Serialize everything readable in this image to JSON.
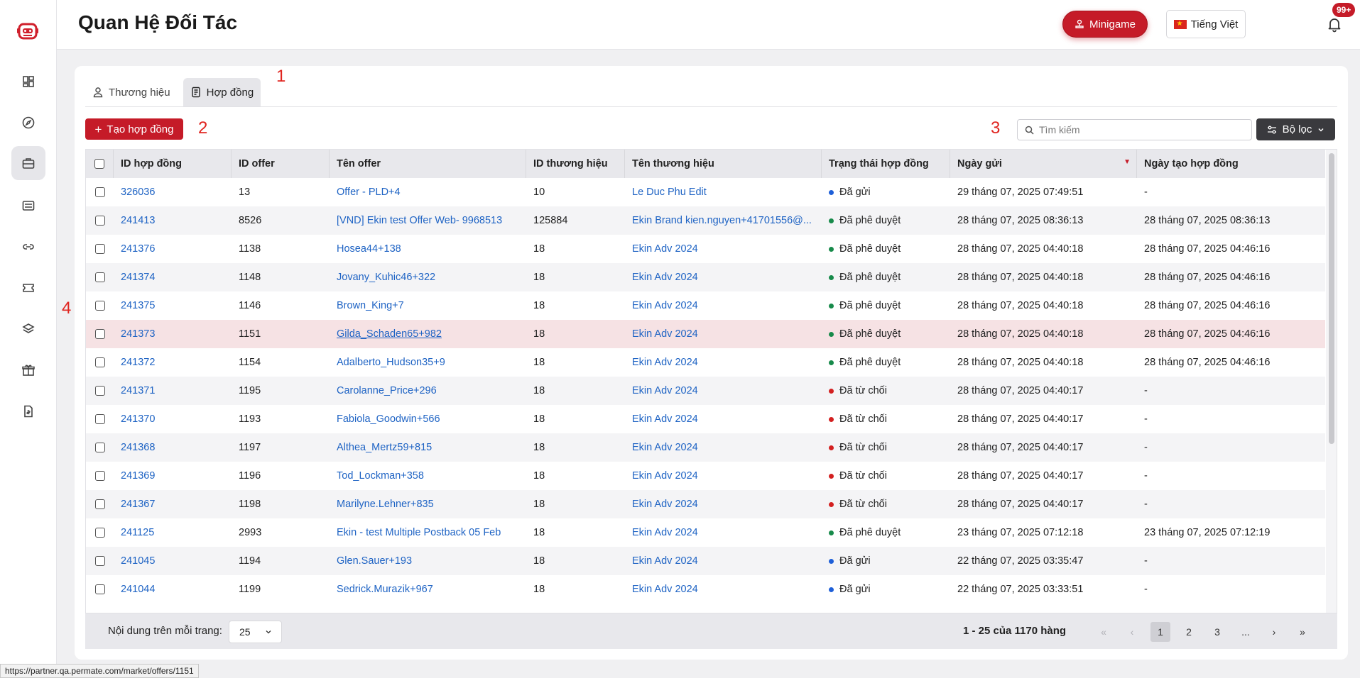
{
  "header": {
    "title": "Quan Hệ Đối Tác",
    "minigame_label": "Minigame",
    "language_label": "Tiếng Việt",
    "notification_badge": "99+"
  },
  "sidebar": {
    "items": [
      {
        "icon": "dashboard-icon",
        "active": false
      },
      {
        "icon": "compass-icon",
        "active": false
      },
      {
        "icon": "briefcase-icon",
        "active": true
      },
      {
        "icon": "sliders-icon",
        "active": false
      },
      {
        "icon": "link-icon",
        "active": false
      },
      {
        "icon": "ticket-icon",
        "active": false
      },
      {
        "icon": "layers-icon",
        "active": false
      },
      {
        "icon": "gift-icon",
        "active": false
      },
      {
        "icon": "invoice-icon",
        "active": false
      }
    ]
  },
  "tabs": [
    {
      "label": "Thương hiệu",
      "active": false,
      "icon": "user-icon"
    },
    {
      "label": "Hợp đồng",
      "active": true,
      "icon": "contract-icon"
    }
  ],
  "annotations": {
    "a1": "1",
    "a2": "2",
    "a3": "3",
    "a4": "4"
  },
  "toolbar": {
    "create_label": "Tạo hợp đồng",
    "search_placeholder": "Tìm kiếm",
    "filter_label": "Bộ lọc"
  },
  "table": {
    "columns": [
      "ID hợp đồng",
      "ID offer",
      "Tên offer",
      "ID thương hiệu",
      "Tên thương hiệu",
      "Trạng thái hợp đồng",
      "Ngày gửi",
      "Ngày tạo hợp đồng"
    ],
    "status_colors": {
      "sent": "#1e5fd8",
      "approved": "#178a4a",
      "rejected": "#d32020"
    },
    "rows": [
      {
        "id": "326036",
        "offer_id": "13",
        "offer_name": "Offer - PLD+4",
        "brand_id": "10",
        "brand_name": "Le Duc Phu Edit",
        "status": "Đã gửi",
        "status_type": "sent",
        "sent": "29 tháng 07, 2025 07:49:51",
        "created": "-"
      },
      {
        "id": "241413",
        "offer_id": "8526",
        "offer_name": "[VND] Ekin test Offer Web- 9968513",
        "brand_id": "125884",
        "brand_name": "Ekin Brand kien.nguyen+41701556@...",
        "status": "Đã phê duyệt",
        "status_type": "approved",
        "sent": "28 tháng 07, 2025 08:36:13",
        "created": "28 tháng 07, 2025 08:36:13"
      },
      {
        "id": "241376",
        "offer_id": "1138",
        "offer_name": "Hosea44+138",
        "brand_id": "18",
        "brand_name": "Ekin Adv 2024",
        "status": "Đã phê duyệt",
        "status_type": "approved",
        "sent": "28 tháng 07, 2025 04:40:18",
        "created": "28 tháng 07, 2025 04:46:16"
      },
      {
        "id": "241374",
        "offer_id": "1148",
        "offer_name": "Jovany_Kuhic46+322",
        "brand_id": "18",
        "brand_name": "Ekin Adv 2024",
        "status": "Đã phê duyệt",
        "status_type": "approved",
        "sent": "28 tháng 07, 2025 04:40:18",
        "created": "28 tháng 07, 2025 04:46:16"
      },
      {
        "id": "241375",
        "offer_id": "1146",
        "offer_name": "Brown_King+7",
        "brand_id": "18",
        "brand_name": "Ekin Adv 2024",
        "status": "Đã phê duyệt",
        "status_type": "approved",
        "sent": "28 tháng 07, 2025 04:40:18",
        "created": "28 tháng 07, 2025 04:46:16"
      },
      {
        "id": "241373",
        "offer_id": "1151",
        "offer_name": "Gilda_Schaden65+982",
        "brand_id": "18",
        "brand_name": "Ekin Adv 2024",
        "status": "Đã phê duyệt",
        "status_type": "approved",
        "sent": "28 tháng 07, 2025 04:40:18",
        "created": "28 tháng 07, 2025 04:46:16",
        "hovered": true
      },
      {
        "id": "241372",
        "offer_id": "1154",
        "offer_name": "Adalberto_Hudson35+9",
        "brand_id": "18",
        "brand_name": "Ekin Adv 2024",
        "status": "Đã phê duyệt",
        "status_type": "approved",
        "sent": "28 tháng 07, 2025 04:40:18",
        "created": "28 tháng 07, 2025 04:46:16"
      },
      {
        "id": "241371",
        "offer_id": "1195",
        "offer_name": "Carolanne_Price+296",
        "brand_id": "18",
        "brand_name": "Ekin Adv 2024",
        "status": "Đã từ chối",
        "status_type": "rejected",
        "sent": "28 tháng 07, 2025 04:40:17",
        "created": "-"
      },
      {
        "id": "241370",
        "offer_id": "1193",
        "offer_name": "Fabiola_Goodwin+566",
        "brand_id": "18",
        "brand_name": "Ekin Adv 2024",
        "status": "Đã từ chối",
        "status_type": "rejected",
        "sent": "28 tháng 07, 2025 04:40:17",
        "created": "-"
      },
      {
        "id": "241368",
        "offer_id": "1197",
        "offer_name": "Althea_Mertz59+815",
        "brand_id": "18",
        "brand_name": "Ekin Adv 2024",
        "status": "Đã từ chối",
        "status_type": "rejected",
        "sent": "28 tháng 07, 2025 04:40:17",
        "created": "-"
      },
      {
        "id": "241369",
        "offer_id": "1196",
        "offer_name": "Tod_Lockman+358",
        "brand_id": "18",
        "brand_name": "Ekin Adv 2024",
        "status": "Đã từ chối",
        "status_type": "rejected",
        "sent": "28 tháng 07, 2025 04:40:17",
        "created": "-"
      },
      {
        "id": "241367",
        "offer_id": "1198",
        "offer_name": "Marilyne.Lehner+835",
        "brand_id": "18",
        "brand_name": "Ekin Adv 2024",
        "status": "Đã từ chối",
        "status_type": "rejected",
        "sent": "28 tháng 07, 2025 04:40:17",
        "created": "-"
      },
      {
        "id": "241125",
        "offer_id": "2993",
        "offer_name": "Ekin - test Multiple Postback 05 Feb",
        "brand_id": "18",
        "brand_name": "Ekin Adv 2024",
        "status": "Đã phê duyệt",
        "status_type": "approved",
        "sent": "23 tháng 07, 2025 07:12:18",
        "created": "23 tháng 07, 2025 07:12:19"
      },
      {
        "id": "241045",
        "offer_id": "1194",
        "offer_name": "Glen.Sauer+193",
        "brand_id": "18",
        "brand_name": "Ekin Adv 2024",
        "status": "Đã gửi",
        "status_type": "sent",
        "sent": "22 tháng 07, 2025 03:35:47",
        "created": "-"
      },
      {
        "id": "241044",
        "offer_id": "1199",
        "offer_name": "Sedrick.Murazik+967",
        "brand_id": "18",
        "brand_name": "Ekin Adv 2024",
        "status": "Đã gửi",
        "status_type": "sent",
        "sent": "22 tháng 07, 2025 03:33:51",
        "created": "-"
      }
    ]
  },
  "footer": {
    "per_page_label": "Nội dung trên mỗi trang:",
    "per_page_value": "25",
    "range_text": "1 - 25 của 1170 hàng",
    "pages": [
      "1",
      "2",
      "3",
      "..."
    ],
    "first": "«",
    "prev": "‹",
    "next": "›",
    "last": "»"
  },
  "statusbar": {
    "url": "https://partner.qa.permate.com/market/offers/1151"
  }
}
